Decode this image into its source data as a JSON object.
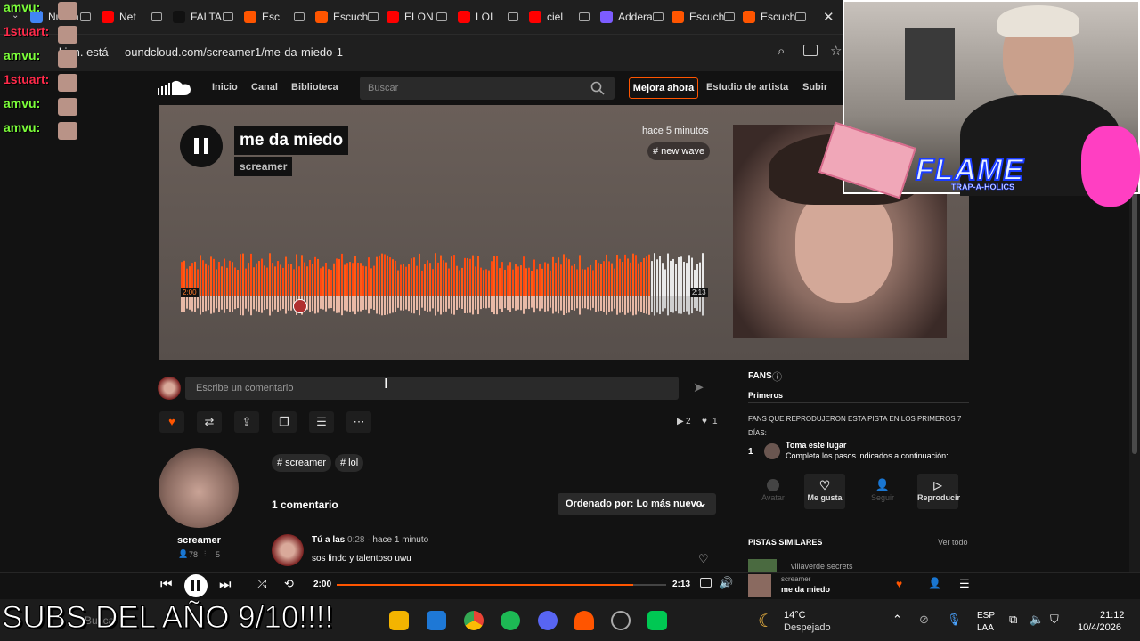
{
  "browser": {
    "tabs": [
      {
        "label": "Nueva",
        "color": "#4285f4"
      },
      {
        "label": "Net",
        "color": "#ff0000"
      },
      {
        "label": "FALTA",
        "color": "#111111"
      },
      {
        "label": "Esc",
        "color": "#ff5500"
      },
      {
        "label": "Escuch",
        "color": "#ff5500"
      },
      {
        "label": "ELON",
        "color": "#ff0000"
      },
      {
        "label": "LOI",
        "color": "#ff0000"
      },
      {
        "label": "ciel",
        "color": "#ff0000"
      },
      {
        "label": "Addera",
        "color": "#7c5cff"
      },
      {
        "label": "Escuch",
        "color": "#ff5500"
      },
      {
        "label": "Escuch",
        "color": "#ff5500"
      }
    ],
    "url_prefix": "kien. está",
    "url": "oundcloud.com/screamer1/me-da-miedo-1"
  },
  "site": {
    "nav": [
      "Inicio",
      "Canal",
      "Biblioteca"
    ],
    "search_placeholder": "Buscar",
    "upgrade": "Mejora ahora",
    "artist_studio": "Estudio de artista",
    "upload": "Subir"
  },
  "track": {
    "title": "me da miedo",
    "artist": "screamer",
    "posted": "hace 5 minutos",
    "genre": "# new wave",
    "elapsed": "2:00",
    "duration": "2:13",
    "progress": 0.9
  },
  "comment_input": {
    "placeholder": "Escribe un comentario"
  },
  "stats": {
    "plays": "2",
    "likes": "1"
  },
  "tags": [
    "# screamer",
    "# lol"
  ],
  "uploader": {
    "name": "screamer",
    "followers": "78",
    "tracks": "5"
  },
  "comments": {
    "count_label": "1 comentario",
    "sort_label": "Ordenado por: Lo más nuevo",
    "items": [
      {
        "author": "Tú a las",
        "time": "0:28",
        "ago": "· hace 1 minuto",
        "text": "sos lindo y talentoso uwu"
      }
    ]
  },
  "fans": {
    "header": "FANS",
    "tab": "Primeros",
    "desc": "FANS QUE REPRODUJERON ESTA PISTA EN LOS PRIMEROS 7 DÍAS:",
    "rank": "1",
    "item_title": "Toma este lugar",
    "item_sub": "Completa los pasos indicados a continuación:",
    "buttons": [
      "Avatar",
      "Me gusta",
      "Seguir",
      "Reproducir"
    ]
  },
  "similar": {
    "header": "PISTAS SIMILARES",
    "see_all": "Ver todo",
    "first": "villaverde secrets"
  },
  "player": {
    "elapsed": "2:00",
    "duration": "2:13",
    "artist": "screamer",
    "title": "me da miedo",
    "progress": 0.9
  },
  "taskbar": {
    "search": "Buscar",
    "weather_temp": "14°C",
    "weather_desc": "Despejado",
    "lang1": "ESP",
    "lang2": "LAA",
    "time": "21:12",
    "date": "10/4/2026"
  },
  "overlay": {
    "caption": "SUBS DEL AÑO 9/10!!!!",
    "chat": [
      {
        "user": "amvu:",
        "color": "#7cff3a"
      },
      {
        "user": "1stuart:",
        "color": "#ff2a4a"
      },
      {
        "user": "amvu:",
        "color": "#7cff3a"
      },
      {
        "user": "1stuart:",
        "color": "#ff2a4a"
      },
      {
        "user": "amvu:",
        "color": "#7cff3a"
      },
      {
        "user": "amvu:",
        "color": "#7cff3a"
      }
    ],
    "webcam_logo": "FLAME",
    "webcam_sub": "TRAP-A-HOLICS"
  },
  "colors": {
    "accent": "#ff5500"
  }
}
